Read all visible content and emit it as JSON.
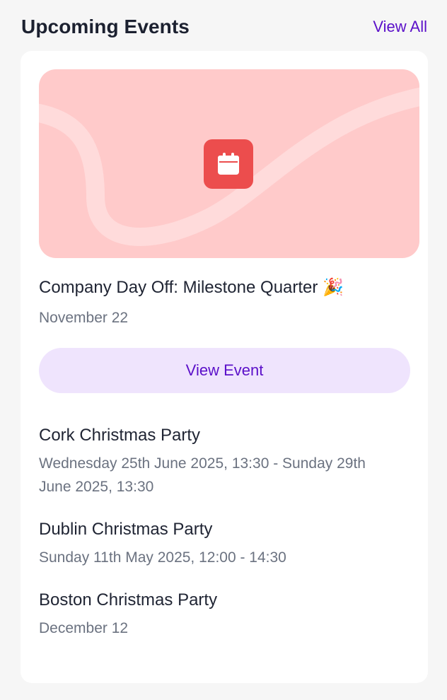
{
  "header": {
    "title": "Upcoming Events",
    "view_all_label": "View All"
  },
  "featured": {
    "banner_color": "#ffcaca",
    "icon": "calendar-icon",
    "icon_color": "#ec4d4d",
    "title": "Company Day Off: Milestone Quarter",
    "emoji": "🎉",
    "date": "November 22",
    "button_label": "View Event"
  },
  "events": [
    {
      "name": "Cork Christmas Party",
      "date": "Wednesday 25th June 2025, 13:30 - Sunday 29th June 2025, 13:30"
    },
    {
      "name": "Dublin Christmas Party",
      "date": "Sunday 11th May 2025, 12:00 - 14:30"
    },
    {
      "name": "Boston Christmas Party",
      "date": "December 12"
    }
  ],
  "colors": {
    "accent": "#5b10c9",
    "button_bg": "#efe4fd",
    "muted_text": "#6b7280"
  }
}
